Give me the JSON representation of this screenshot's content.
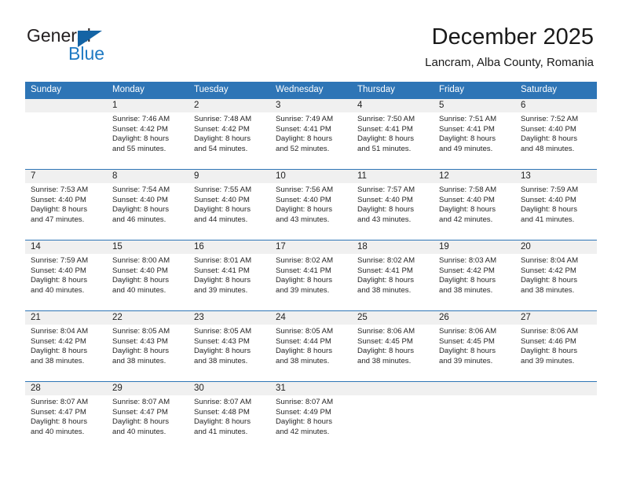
{
  "brand": {
    "name_part1": "General",
    "name_part2": "Blue",
    "accent_color": "#1464a5"
  },
  "header": {
    "title": "December 2025",
    "subtitle": "Lancram, Alba County, Romania"
  },
  "calendar": {
    "header_color": "#2e75b6",
    "daynum_band_color": "#f0f0f0",
    "weekdays": [
      "Sunday",
      "Monday",
      "Tuesday",
      "Wednesday",
      "Thursday",
      "Friday",
      "Saturday"
    ],
    "weeks": [
      [
        {
          "day": "",
          "sunrise": "",
          "sunset": "",
          "daylight_line1": "",
          "daylight_line2": ""
        },
        {
          "day": "1",
          "sunrise": "Sunrise: 7:46 AM",
          "sunset": "Sunset: 4:42 PM",
          "daylight_line1": "Daylight: 8 hours",
          "daylight_line2": "and 55 minutes."
        },
        {
          "day": "2",
          "sunrise": "Sunrise: 7:48 AM",
          "sunset": "Sunset: 4:42 PM",
          "daylight_line1": "Daylight: 8 hours",
          "daylight_line2": "and 54 minutes."
        },
        {
          "day": "3",
          "sunrise": "Sunrise: 7:49 AM",
          "sunset": "Sunset: 4:41 PM",
          "daylight_line1": "Daylight: 8 hours",
          "daylight_line2": "and 52 minutes."
        },
        {
          "day": "4",
          "sunrise": "Sunrise: 7:50 AM",
          "sunset": "Sunset: 4:41 PM",
          "daylight_line1": "Daylight: 8 hours",
          "daylight_line2": "and 51 minutes."
        },
        {
          "day": "5",
          "sunrise": "Sunrise: 7:51 AM",
          "sunset": "Sunset: 4:41 PM",
          "daylight_line1": "Daylight: 8 hours",
          "daylight_line2": "and 49 minutes."
        },
        {
          "day": "6",
          "sunrise": "Sunrise: 7:52 AM",
          "sunset": "Sunset: 4:40 PM",
          "daylight_line1": "Daylight: 8 hours",
          "daylight_line2": "and 48 minutes."
        }
      ],
      [
        {
          "day": "7",
          "sunrise": "Sunrise: 7:53 AM",
          "sunset": "Sunset: 4:40 PM",
          "daylight_line1": "Daylight: 8 hours",
          "daylight_line2": "and 47 minutes."
        },
        {
          "day": "8",
          "sunrise": "Sunrise: 7:54 AM",
          "sunset": "Sunset: 4:40 PM",
          "daylight_line1": "Daylight: 8 hours",
          "daylight_line2": "and 46 minutes."
        },
        {
          "day": "9",
          "sunrise": "Sunrise: 7:55 AM",
          "sunset": "Sunset: 4:40 PM",
          "daylight_line1": "Daylight: 8 hours",
          "daylight_line2": "and 44 minutes."
        },
        {
          "day": "10",
          "sunrise": "Sunrise: 7:56 AM",
          "sunset": "Sunset: 4:40 PM",
          "daylight_line1": "Daylight: 8 hours",
          "daylight_line2": "and 43 minutes."
        },
        {
          "day": "11",
          "sunrise": "Sunrise: 7:57 AM",
          "sunset": "Sunset: 4:40 PM",
          "daylight_line1": "Daylight: 8 hours",
          "daylight_line2": "and 43 minutes."
        },
        {
          "day": "12",
          "sunrise": "Sunrise: 7:58 AM",
          "sunset": "Sunset: 4:40 PM",
          "daylight_line1": "Daylight: 8 hours",
          "daylight_line2": "and 42 minutes."
        },
        {
          "day": "13",
          "sunrise": "Sunrise: 7:59 AM",
          "sunset": "Sunset: 4:40 PM",
          "daylight_line1": "Daylight: 8 hours",
          "daylight_line2": "and 41 minutes."
        }
      ],
      [
        {
          "day": "14",
          "sunrise": "Sunrise: 7:59 AM",
          "sunset": "Sunset: 4:40 PM",
          "daylight_line1": "Daylight: 8 hours",
          "daylight_line2": "and 40 minutes."
        },
        {
          "day": "15",
          "sunrise": "Sunrise: 8:00 AM",
          "sunset": "Sunset: 4:40 PM",
          "daylight_line1": "Daylight: 8 hours",
          "daylight_line2": "and 40 minutes."
        },
        {
          "day": "16",
          "sunrise": "Sunrise: 8:01 AM",
          "sunset": "Sunset: 4:41 PM",
          "daylight_line1": "Daylight: 8 hours",
          "daylight_line2": "and 39 minutes."
        },
        {
          "day": "17",
          "sunrise": "Sunrise: 8:02 AM",
          "sunset": "Sunset: 4:41 PM",
          "daylight_line1": "Daylight: 8 hours",
          "daylight_line2": "and 39 minutes."
        },
        {
          "day": "18",
          "sunrise": "Sunrise: 8:02 AM",
          "sunset": "Sunset: 4:41 PM",
          "daylight_line1": "Daylight: 8 hours",
          "daylight_line2": "and 38 minutes."
        },
        {
          "day": "19",
          "sunrise": "Sunrise: 8:03 AM",
          "sunset": "Sunset: 4:42 PM",
          "daylight_line1": "Daylight: 8 hours",
          "daylight_line2": "and 38 minutes."
        },
        {
          "day": "20",
          "sunrise": "Sunrise: 8:04 AM",
          "sunset": "Sunset: 4:42 PM",
          "daylight_line1": "Daylight: 8 hours",
          "daylight_line2": "and 38 minutes."
        }
      ],
      [
        {
          "day": "21",
          "sunrise": "Sunrise: 8:04 AM",
          "sunset": "Sunset: 4:42 PM",
          "daylight_line1": "Daylight: 8 hours",
          "daylight_line2": "and 38 minutes."
        },
        {
          "day": "22",
          "sunrise": "Sunrise: 8:05 AM",
          "sunset": "Sunset: 4:43 PM",
          "daylight_line1": "Daylight: 8 hours",
          "daylight_line2": "and 38 minutes."
        },
        {
          "day": "23",
          "sunrise": "Sunrise: 8:05 AM",
          "sunset": "Sunset: 4:43 PM",
          "daylight_line1": "Daylight: 8 hours",
          "daylight_line2": "and 38 minutes."
        },
        {
          "day": "24",
          "sunrise": "Sunrise: 8:05 AM",
          "sunset": "Sunset: 4:44 PM",
          "daylight_line1": "Daylight: 8 hours",
          "daylight_line2": "and 38 minutes."
        },
        {
          "day": "25",
          "sunrise": "Sunrise: 8:06 AM",
          "sunset": "Sunset: 4:45 PM",
          "daylight_line1": "Daylight: 8 hours",
          "daylight_line2": "and 38 minutes."
        },
        {
          "day": "26",
          "sunrise": "Sunrise: 8:06 AM",
          "sunset": "Sunset: 4:45 PM",
          "daylight_line1": "Daylight: 8 hours",
          "daylight_line2": "and 39 minutes."
        },
        {
          "day": "27",
          "sunrise": "Sunrise: 8:06 AM",
          "sunset": "Sunset: 4:46 PM",
          "daylight_line1": "Daylight: 8 hours",
          "daylight_line2": "and 39 minutes."
        }
      ],
      [
        {
          "day": "28",
          "sunrise": "Sunrise: 8:07 AM",
          "sunset": "Sunset: 4:47 PM",
          "daylight_line1": "Daylight: 8 hours",
          "daylight_line2": "and 40 minutes."
        },
        {
          "day": "29",
          "sunrise": "Sunrise: 8:07 AM",
          "sunset": "Sunset: 4:47 PM",
          "daylight_line1": "Daylight: 8 hours",
          "daylight_line2": "and 40 minutes."
        },
        {
          "day": "30",
          "sunrise": "Sunrise: 8:07 AM",
          "sunset": "Sunset: 4:48 PM",
          "daylight_line1": "Daylight: 8 hours",
          "daylight_line2": "and 41 minutes."
        },
        {
          "day": "31",
          "sunrise": "Sunrise: 8:07 AM",
          "sunset": "Sunset: 4:49 PM",
          "daylight_line1": "Daylight: 8 hours",
          "daylight_line2": "and 42 minutes."
        },
        {
          "day": "",
          "sunrise": "",
          "sunset": "",
          "daylight_line1": "",
          "daylight_line2": ""
        },
        {
          "day": "",
          "sunrise": "",
          "sunset": "",
          "daylight_line1": "",
          "daylight_line2": ""
        },
        {
          "day": "",
          "sunrise": "",
          "sunset": "",
          "daylight_line1": "",
          "daylight_line2": ""
        }
      ]
    ]
  }
}
